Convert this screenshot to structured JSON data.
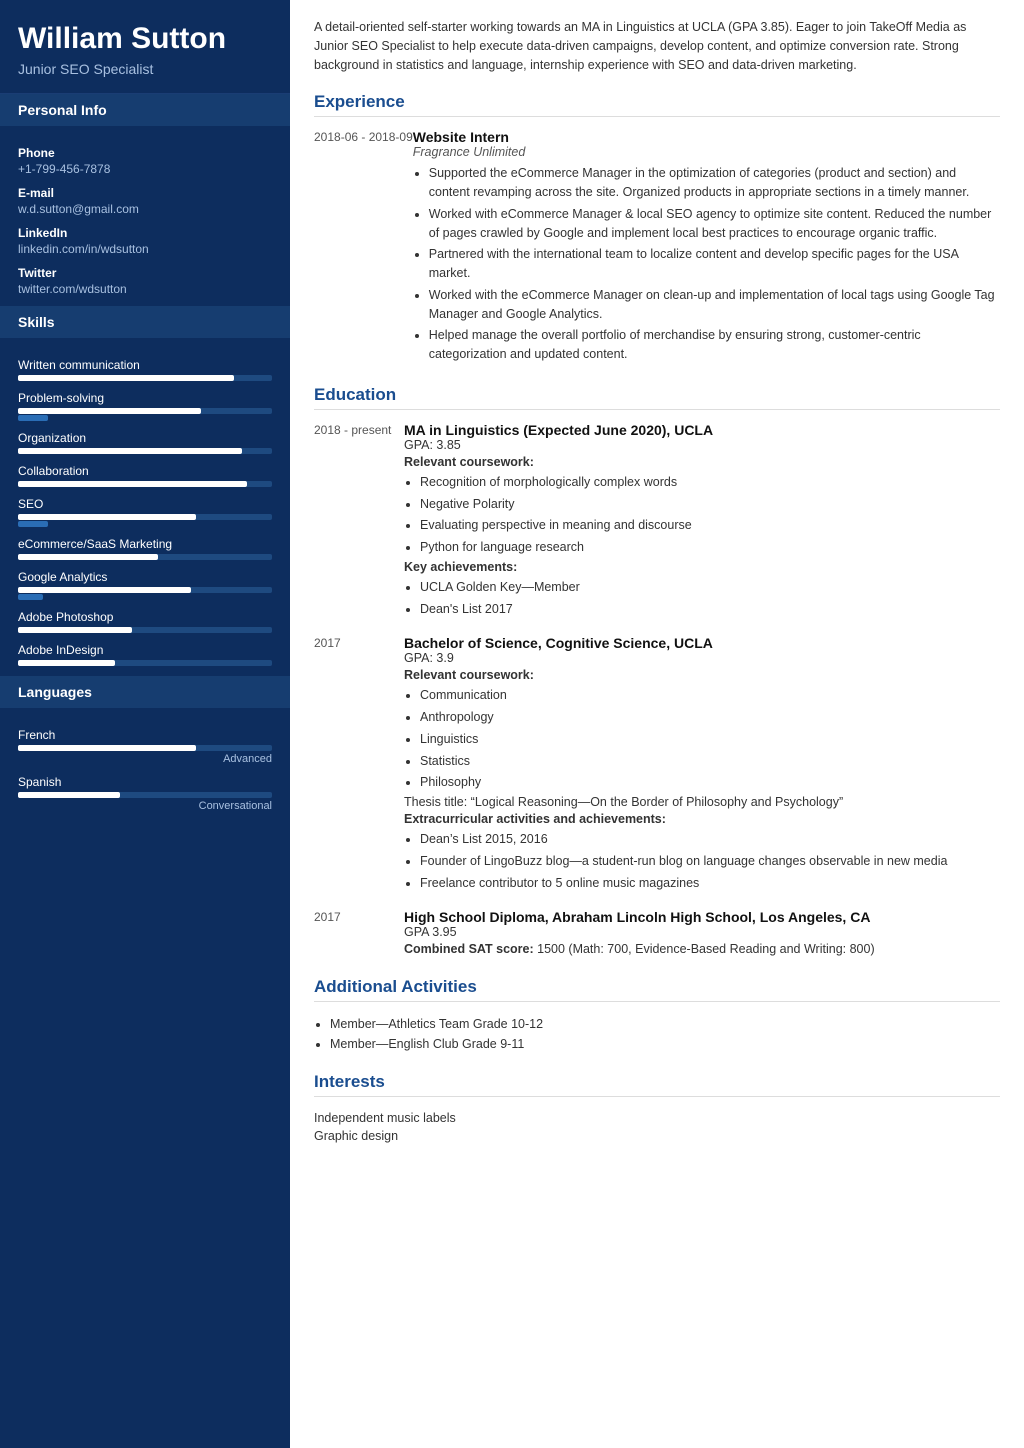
{
  "sidebar": {
    "name": "William Sutton",
    "title": "Junior SEO Specialist",
    "sections": {
      "personal_info_label": "Personal Info",
      "fields": [
        {
          "label": "Phone",
          "value": "+1-799-456-7878"
        },
        {
          "label": "E-mail",
          "value": "w.d.sutton@gmail.com"
        },
        {
          "label": "LinkedIn",
          "value": "linkedin.com/in/wdsutton"
        },
        {
          "label": "Twitter",
          "value": "twitter.com/wdsutton"
        }
      ],
      "skills_label": "Skills",
      "skills": [
        {
          "name": "Written communication",
          "fill": 85,
          "accent": 0
        },
        {
          "name": "Problem-solving",
          "fill": 72,
          "accent": 12
        },
        {
          "name": "Organization",
          "fill": 88,
          "accent": 0
        },
        {
          "name": "Collaboration",
          "fill": 90,
          "accent": 0
        },
        {
          "name": "SEO",
          "fill": 70,
          "accent": 12
        },
        {
          "name": "eCommerce/SaaS Marketing",
          "fill": 55,
          "accent": 0
        },
        {
          "name": "Google Analytics",
          "fill": 68,
          "accent": 10
        },
        {
          "name": "Adobe Photoshop",
          "fill": 45,
          "accent": 0
        },
        {
          "name": "Adobe InDesign",
          "fill": 38,
          "accent": 0
        }
      ],
      "languages_label": "Languages",
      "languages": [
        {
          "name": "French",
          "fill": 70,
          "level": "Advanced"
        },
        {
          "name": "Spanish",
          "fill": 40,
          "level": "Conversational"
        }
      ]
    }
  },
  "main": {
    "summary": "A detail-oriented self-starter working towards an MA in Linguistics at UCLA (GPA 3.85). Eager to join TakeOff Media as Junior SEO Specialist to help execute data-driven campaigns, develop content, and optimize conversion rate. Strong background in statistics and language, internship experience with SEO and data-driven marketing.",
    "experience_label": "Experience",
    "experience": [
      {
        "date": "2018-06 - 2018-09",
        "title": "Website Intern",
        "company": "Fragrance Unlimited",
        "bullets": [
          "Supported the eCommerce Manager in the optimization of categories (product and section) and content revamping across the site. Organized products in appropriate sections in a timely manner.",
          "Worked with eCommerce Manager & local SEO agency to optimize site content. Reduced the number of pages crawled by Google and implement local best practices to encourage organic traffic.",
          "Partnered with the international team to localize content and develop specific pages for the USA market.",
          "Worked with the eCommerce Manager on clean-up and implementation of local tags using Google Tag Manager and Google Analytics.",
          "Helped manage the overall portfolio of merchandise by ensuring strong, customer-centric categorization and updated content."
        ]
      }
    ],
    "education_label": "Education",
    "education": [
      {
        "date": "2018 - present",
        "title": "MA in Linguistics (Expected June 2020), UCLA",
        "gpa": "GPA: 3.85",
        "coursework_label": "Relevant coursework:",
        "coursework": [
          "Recognition of morphologically complex words",
          "Negative Polarity",
          "Evaluating perspective in meaning and discourse",
          "Python for language research"
        ],
        "achievements_label": "Key achievements:",
        "achievements": [
          "UCLA Golden Key—Member",
          "Dean's List 2017"
        ]
      },
      {
        "date": "2017",
        "title": "Bachelor of Science, Cognitive Science, UCLA",
        "gpa": "GPA: 3.9",
        "coursework_label": "Relevant coursework:",
        "coursework": [
          "Communication",
          "Anthropology",
          "Linguistics",
          "Statistics",
          "Philosophy"
        ],
        "thesis": "Thesis title: “Logical Reasoning—On the Border of Philosophy and Psychology”",
        "extra_label": "Extracurricular activities and achievements:",
        "extras": [
          "Dean’s List 2015, 2016",
          "Founder of LingoBuzz blog—a student-run blog on language changes observable in new media",
          "Freelance contributor to 5 online music magazines"
        ]
      },
      {
        "date": "2017",
        "title": "High School Diploma, Abraham Lincoln High School, Los Angeles, CA",
        "gpa": "GPA 3.95",
        "sat": "Combined SAT score: 1500 (Math: 700, Evidence-Based Reading and Writing: 800)"
      }
    ],
    "additional_label": "Additional Activities",
    "additional": [
      "Member—Athletics Team Grade 10-12",
      "Member—English Club Grade 9-11"
    ],
    "interests_label": "Interests",
    "interests": [
      "Independent music labels",
      "Graphic design"
    ]
  }
}
